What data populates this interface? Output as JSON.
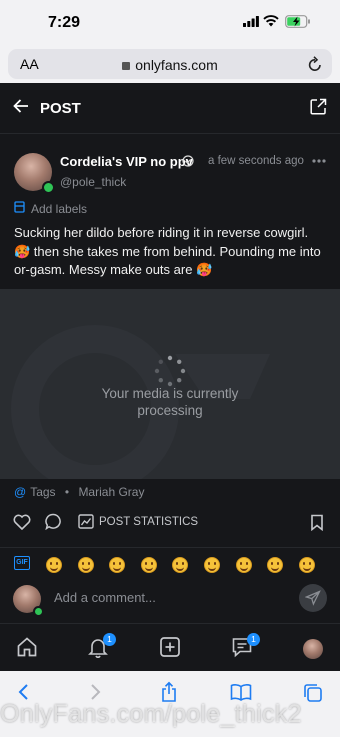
{
  "status_bar": {
    "time": "7:29"
  },
  "browser": {
    "aa_label": "AA",
    "domain": "onlyfans.com"
  },
  "header": {
    "title": "POST"
  },
  "post": {
    "author": "Cordelia's VIP no ppv",
    "handle": "@pole_thick",
    "timestamp": "a few seconds ago",
    "add_labels": "Add labels",
    "caption": "Sucking her dildo before riding it in reverse cowgirl. 🥵 then she takes me from behind. Pounding me into or-gasm. Messy make outs are 🥵",
    "media_status_line1": "Your media is currently",
    "media_status_line2": "processing",
    "tags_label": "Tags",
    "tag_separator": "•",
    "tag_name": "Mariah Gray",
    "stats_label": "POST STATISTICS"
  },
  "emoji_bar": {
    "gif_label": "GIF",
    "emojis": [
      "grinning",
      "beaming",
      "joy",
      "smiley",
      "smile",
      "sweat-smile",
      "laughing",
      "relieved",
      "blush"
    ]
  },
  "comment": {
    "placeholder": "Add a comment..."
  },
  "bottom_nav": {
    "notifications_badge": "1",
    "messages_badge": "1"
  },
  "watermark": "OnlyFans.com/pole_thick2",
  "colors": {
    "accent": "#1e90ff",
    "online": "#2fc456",
    "background": "#16171a"
  }
}
